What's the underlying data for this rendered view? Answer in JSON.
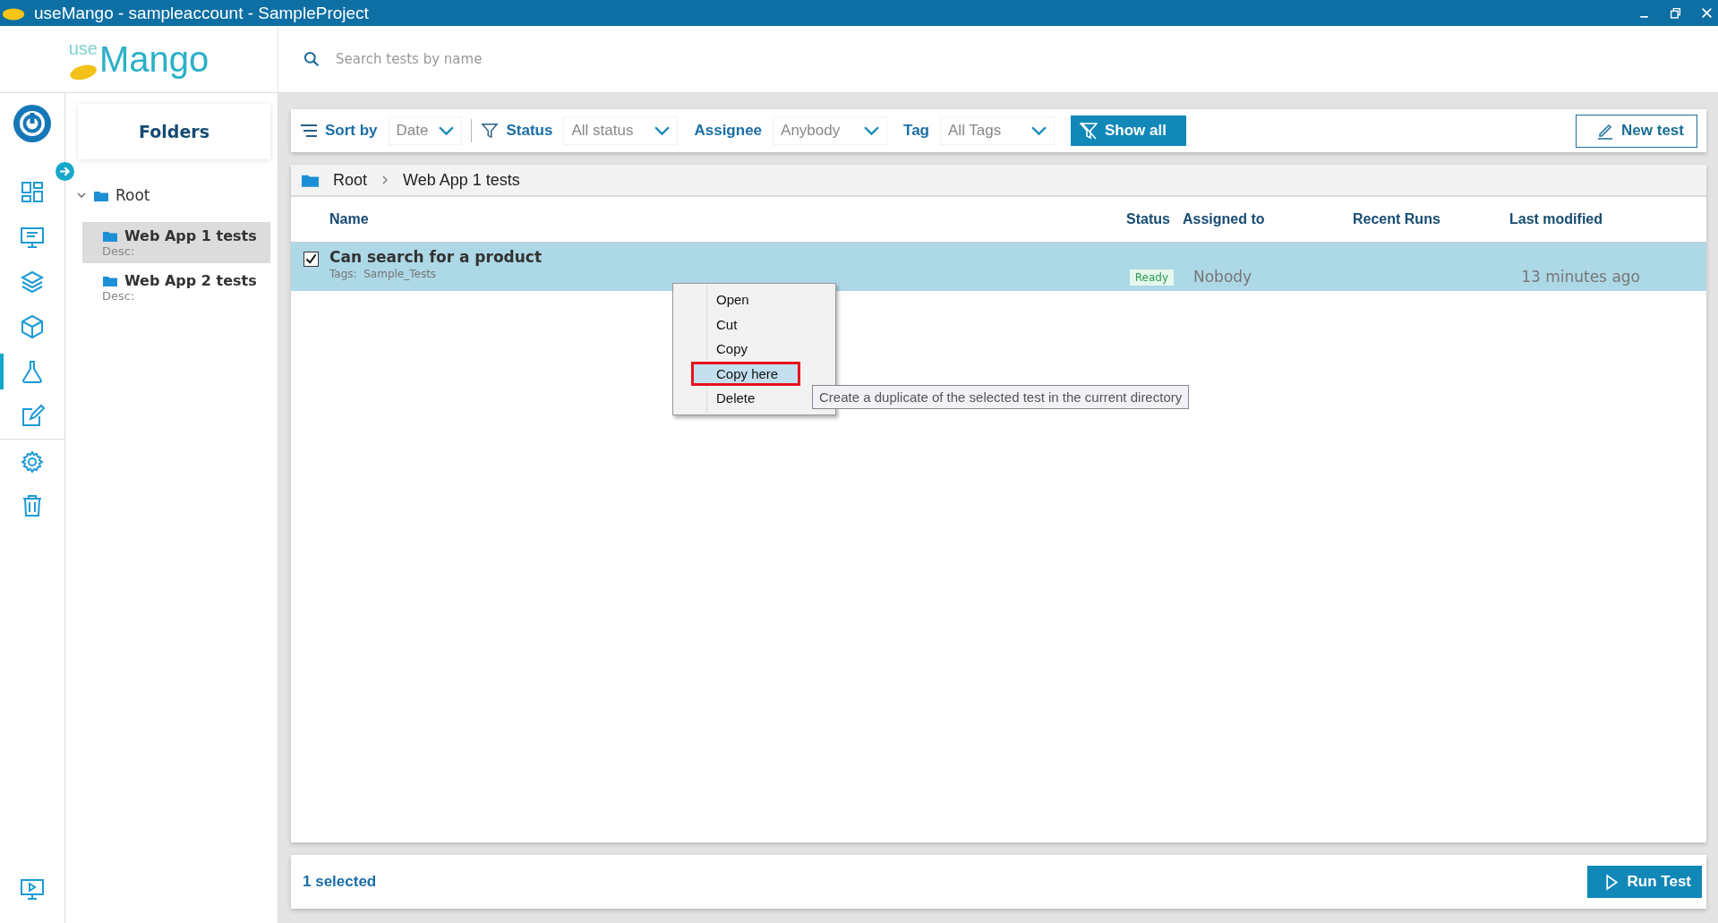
{
  "window": {
    "title": "useMango - sampleaccount - SampleProject"
  },
  "logo": {
    "prefix": "use",
    "name": "Mango"
  },
  "search": {
    "placeholder": "Search tests by name"
  },
  "nav": [
    {
      "kind": "dashboard",
      "selected": false
    },
    {
      "kind": "monitor",
      "selected": false
    },
    {
      "kind": "layers",
      "selected": false
    },
    {
      "kind": "cube",
      "selected": false
    },
    {
      "kind": "flask",
      "selected": true
    },
    {
      "kind": "edit",
      "selected": false
    },
    {
      "kind": "settings",
      "selected": false
    },
    {
      "kind": "trash",
      "selected": false
    }
  ],
  "folders": {
    "title": "Folders",
    "tree": [
      {
        "label": "Root",
        "expanded": true,
        "children": [
          {
            "label": "Web App 1 tests",
            "desc": "Desc:",
            "selected": true
          },
          {
            "label": "Web App 2 tests",
            "desc": "Desc:",
            "selected": false
          }
        ]
      }
    ]
  },
  "toolbar": {
    "sort": {
      "label": "Sort by",
      "value": "Date"
    },
    "filters": [
      {
        "label": "Status",
        "value": "All status"
      },
      {
        "label": "Assignee",
        "value": "Anybody"
      },
      {
        "label": "Tag",
        "value": "All Tags"
      }
    ],
    "show_all": "Show all",
    "new_test": "New test"
  },
  "breadcrumb": [
    "Root",
    "Web App 1 tests"
  ],
  "table": {
    "columns": [
      "Name",
      "Status",
      "Assigned to",
      "Recent Runs",
      "Last modified"
    ],
    "rows": [
      {
        "name": "Can search for a product",
        "tags_label": "Tags:",
        "tags": "Sample_Tests",
        "status": "Ready",
        "assigned_to": "Nobody",
        "last_modified": "13 minutes ago",
        "checked": true,
        "selected": true
      }
    ]
  },
  "context_menu": {
    "items": [
      {
        "label": "Open",
        "selected": false,
        "outlined": false
      },
      {
        "label": "Cut",
        "selected": false,
        "outlined": false
      },
      {
        "label": "Copy",
        "selected": false,
        "outlined": false
      },
      {
        "label": "Copy here",
        "selected": true,
        "outlined": true
      },
      {
        "label": "Delete",
        "selected": false,
        "outlined": false
      }
    ],
    "tooltip": "Create a duplicate of the selected test in the current directory"
  },
  "footer": {
    "selection": "1 selected",
    "run_button": "Run Test"
  }
}
